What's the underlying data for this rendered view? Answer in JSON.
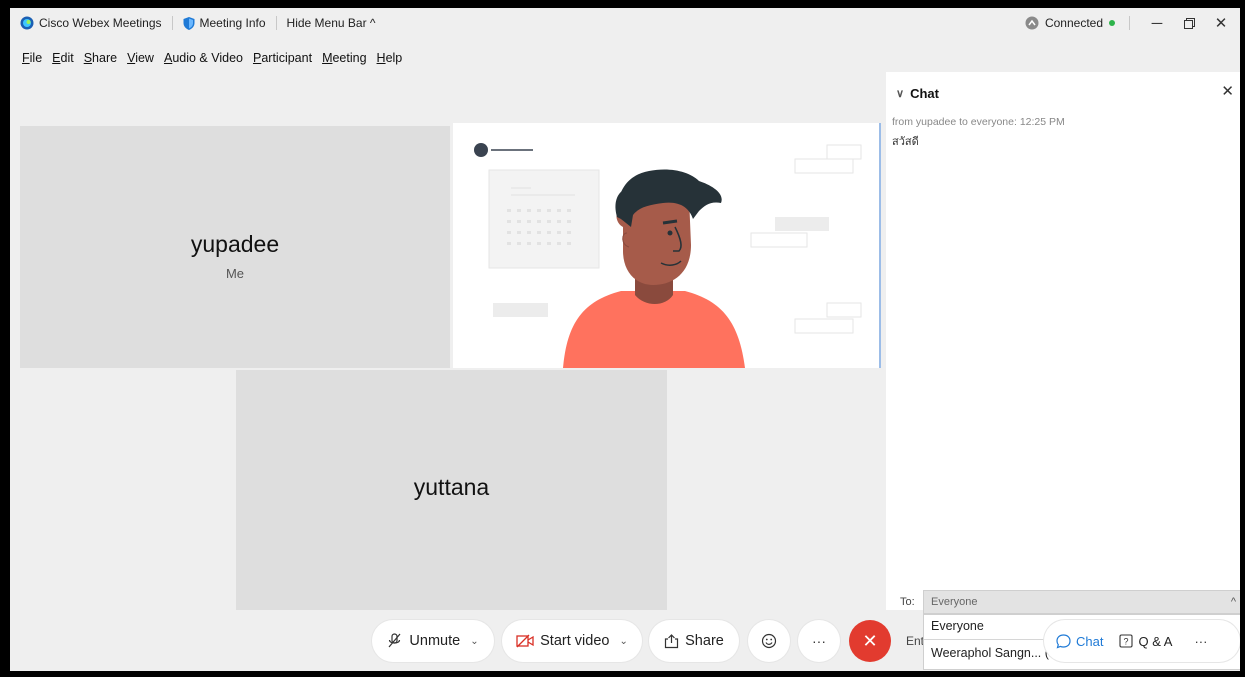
{
  "titlebar": {
    "app_name": "Cisco Webex Meetings",
    "meeting_info": "Meeting Info",
    "hide_menu": "Hide Menu Bar ^",
    "status": "Connected"
  },
  "menu": [
    "File",
    "Edit",
    "Share",
    "View",
    "Audio & Video",
    "Participant",
    "Meeting",
    "Help"
  ],
  "tiles": {
    "self_name": "yupadee",
    "self_sub": "Me",
    "other_name": "yuttana"
  },
  "chat": {
    "title": "Chat",
    "meta": "from yupadee to everyone:   12:25 PM",
    "message": "สวัสดี",
    "to_label": "To:",
    "to_value": "Everyone",
    "options": [
      "Everyone",
      "Weeraphol Sangn...  (Host & Presenter)"
    ],
    "enter_hint": "Ent"
  },
  "controls": {
    "unmute": "Unmute",
    "start_video": "Start video",
    "share": "Share",
    "chat": "Chat",
    "qa": "Q & A",
    "more": "···"
  },
  "colors": {
    "end_call": "#e23b2f",
    "accent": "#1f7ad6",
    "connected_dot": "#2db34a"
  }
}
